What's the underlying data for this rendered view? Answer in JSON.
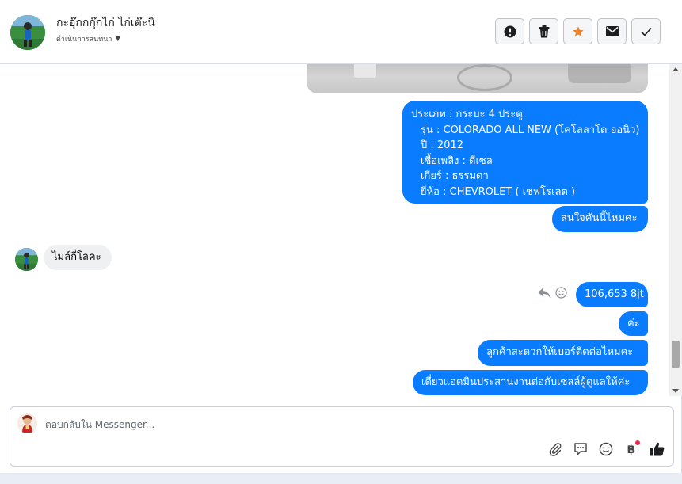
{
  "header": {
    "contact_name": "กะอุ๊กกกุ๊กไก่ ไก่เต๊ะนิ",
    "conversation_action": "ดำเนินการสนทนา",
    "buttons": [
      "report-spam",
      "delete",
      "star",
      "mark-unread",
      "mark-done"
    ]
  },
  "messages": {
    "car_info": {
      "lines": [
        "ประเภท : กระบะ 4 ประตู",
        "รุ่น : COLORADO ALL NEW (โคโลลาโด ออนิว)",
        "ปี : 2012",
        "เชื้อเพลิง : ดีเซล",
        "เกียร์ : ธรรมดา",
        "ยี่ห้อ : CHEVROLET ( เชฟโรเลต )"
      ]
    },
    "out_interest": "สนใจคันนี้ไหมคะ",
    "in_mileage_q": "ไมล์กี่โลคะ",
    "out_mileage": "106,653 8jt",
    "out_ka": "ค่ะ",
    "out_phone_q": "ลูกค้าสะดวกให้เบอร์ติดต่อไหมคะ",
    "out_admin": "เดี๋ยวแอดมินประสานงานต่อกับเซลล์ผู้ดูแลให้ค่ะ"
  },
  "composer": {
    "placeholder": "ตอบกลับใน Messenger...",
    "value": "",
    "baht_symbol": "฿"
  },
  "colors": {
    "outgoing_bubble": "#0a7cff",
    "incoming_bubble": "#eff0f2",
    "star": "#e8842e",
    "notification_dot": "#f02849"
  }
}
